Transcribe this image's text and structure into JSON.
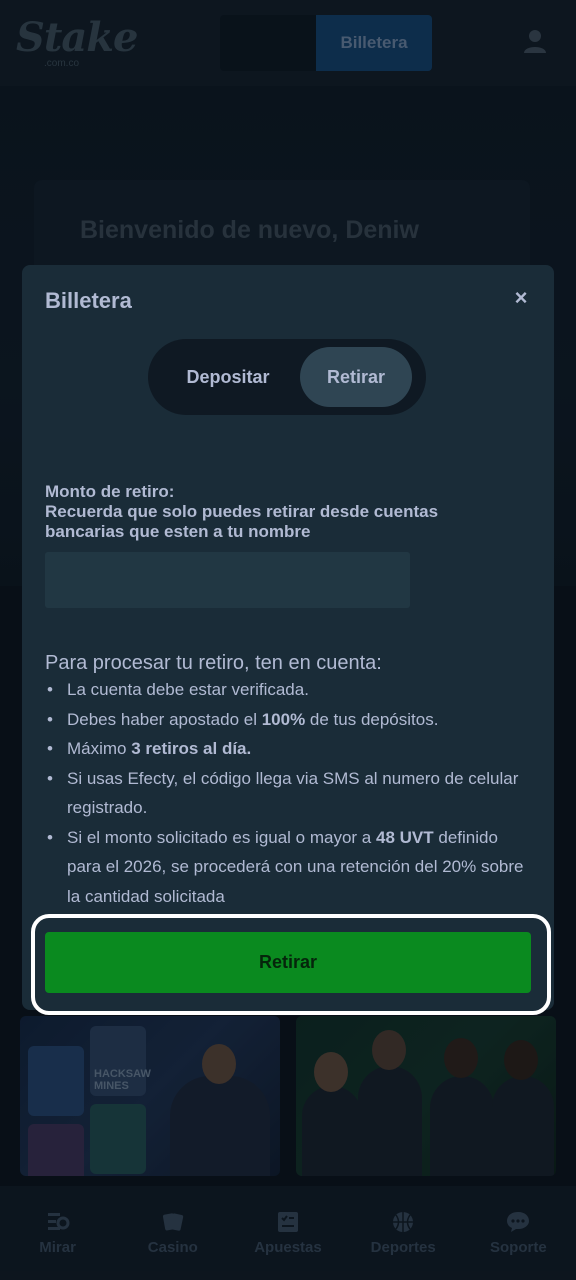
{
  "app": {
    "logo_text": "Stake",
    "logo_sub": ".com.co"
  },
  "header": {
    "wallet_button": "Billetera"
  },
  "background": {
    "welcome": "Bienvenido de nuevo, Deniw",
    "promo_tile_text": "HACKSAW MINES"
  },
  "modal": {
    "title": "Billetera",
    "close": "×",
    "tabs": [
      {
        "label": "Depositar",
        "active": false
      },
      {
        "label": "Retirar",
        "active": true
      }
    ],
    "field_label_1": "Monto de retiro:",
    "field_label_2": "Recuerda que solo puedes retirar desde cuentas bancarias que esten a tu nombre",
    "amount_value": "",
    "info_heading": "Para procesar tu retiro, ten en cuenta:",
    "info_items": [
      {
        "pre": "La cuenta debe estar verificada.",
        "bold": "",
        "post": ""
      },
      {
        "pre": "Debes haber apostado el ",
        "bold": "100%",
        "post": " de tus depósitos."
      },
      {
        "pre": "Máximo ",
        "bold": "3 retiros al día.",
        "post": ""
      },
      {
        "pre": "Si usas Efecty, el código llega via SMS al numero de celular registrado.",
        "bold": "",
        "post": ""
      },
      {
        "pre": "Si el monto solicitado es igual o mayor a ",
        "bold": "48 UVT",
        "post": " definido para el 2026, se procederá con una retención del 20% sobre la cantidad solicitada"
      }
    ],
    "submit": "Retirar"
  },
  "bottom_nav": [
    {
      "label": "Mirar",
      "icon": "watch-icon"
    },
    {
      "label": "Casino",
      "icon": "cards-icon"
    },
    {
      "label": "Apuestas",
      "icon": "betslip-icon"
    },
    {
      "label": "Deportes",
      "icon": "basketball-icon"
    },
    {
      "label": "Soporte",
      "icon": "chat-icon"
    }
  ],
  "colors": {
    "modal_bg": "#1a2c38",
    "input_bg": "#213743",
    "submit_bg": "#0a8a1f",
    "text": "#b1bad3"
  }
}
